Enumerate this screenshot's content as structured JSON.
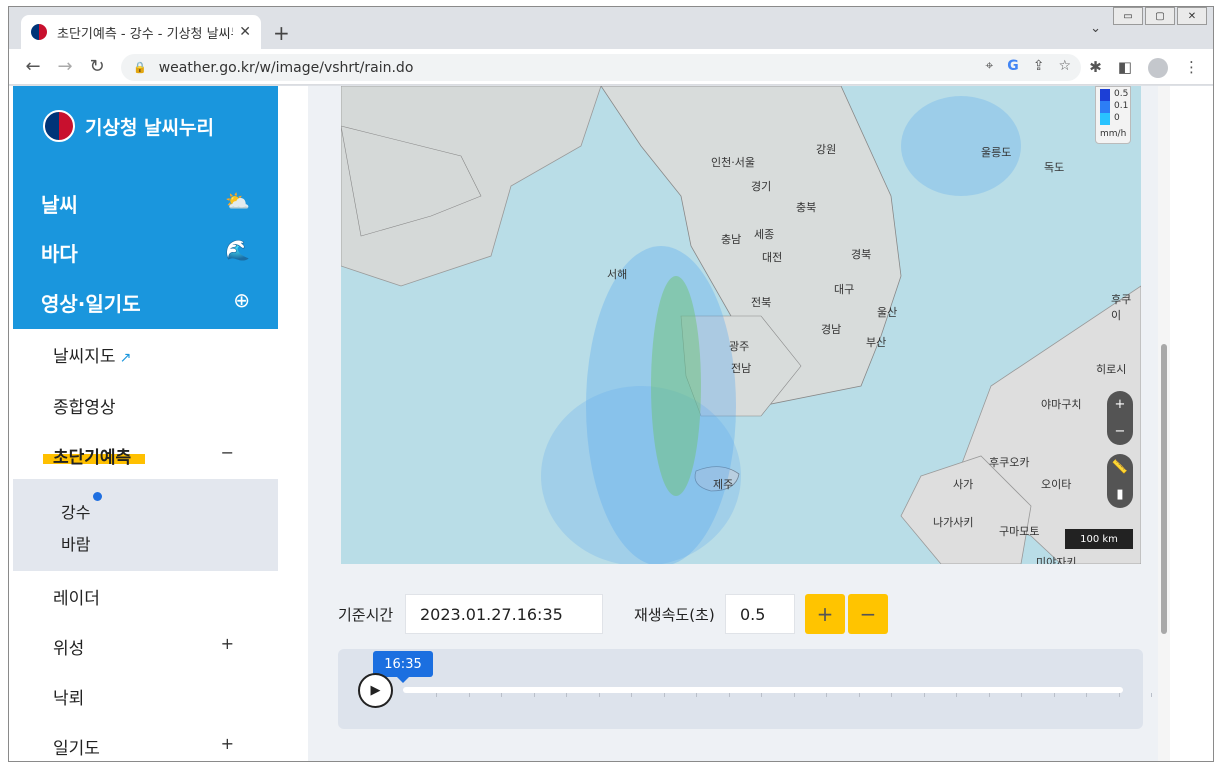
{
  "browser": {
    "tab_title": "초단기예측 - 강수 - 기상청 날씨누리",
    "url": "weather.go.kr/w/image/vshrt/rain.do",
    "new_tab": "+",
    "tab_close": "✕",
    "tabs_dropdown": "⌄",
    "window_controls": [
      "▭",
      "▢",
      "✕"
    ]
  },
  "sidebar": {
    "logo_text": "기상청 날씨누리",
    "main_menu": [
      {
        "label": "날씨",
        "icon": "weather-icon"
      },
      {
        "label": "바다",
        "icon": "wave-icon"
      },
      {
        "label": "영상·일기도",
        "icon": "radar-icon"
      }
    ],
    "sub_menu": [
      {
        "label": "날씨지도",
        "ext": "↗"
      },
      {
        "label": "종합영상"
      },
      {
        "label": "초단기예측",
        "toggle": "−"
      },
      {
        "label": "레이더"
      },
      {
        "label": "위성",
        "toggle": "+"
      },
      {
        "label": "낙뢰"
      },
      {
        "label": "일기도",
        "toggle": "+"
      }
    ],
    "sub_sub_menu": [
      "강수",
      "바람"
    ]
  },
  "map": {
    "labels": [
      {
        "text": "강원"
      },
      {
        "text": "경기"
      },
      {
        "text": "충북"
      },
      {
        "text": "충남"
      },
      {
        "text": "세종"
      },
      {
        "text": "대전"
      },
      {
        "text": "경북"
      },
      {
        "text": "서해"
      },
      {
        "text": "전북"
      },
      {
        "text": "대구"
      },
      {
        "text": "울산"
      },
      {
        "text": "경남"
      },
      {
        "text": "부산"
      },
      {
        "text": "광주"
      },
      {
        "text": "전남"
      },
      {
        "text": "제주"
      },
      {
        "text": "울릉도"
      },
      {
        "text": "독도"
      },
      {
        "text": "야마구치"
      },
      {
        "text": "후쿠오카"
      },
      {
        "text": "오이타"
      },
      {
        "text": "사가"
      },
      {
        "text": "나가사키"
      },
      {
        "text": "구마모토"
      },
      {
        "text": "미야자키"
      },
      {
        "text": "히로시"
      },
      {
        "text": "후쿠이"
      },
      {
        "text": "인천·서울"
      }
    ],
    "legend": {
      "values": [
        "0.5",
        "0.1",
        "0"
      ],
      "unit": "mm/h"
    },
    "scale": "100 km"
  },
  "controls": {
    "base_time_label": "기준시간",
    "base_time_value": "2023.01.27.16:35",
    "speed_label": "재생속도(초)",
    "speed_value": "0.5",
    "plus": "+",
    "minus": "−"
  },
  "timeline": {
    "current": "16:35",
    "play": "▶"
  },
  "colors": {
    "brand": "#1a96dd",
    "accent": "#ffc400",
    "time_tag": "#1b6fe0"
  }
}
